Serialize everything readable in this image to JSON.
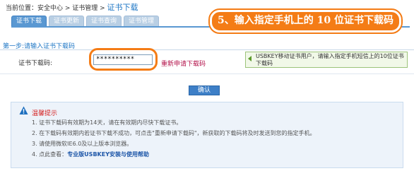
{
  "breadcrumb": {
    "prefix": "当前位置：安全中心 > 证书管理 > ",
    "current": "证书下载"
  },
  "tabs": [
    {
      "label": "证书下载",
      "active": true
    },
    {
      "label": "证书更新",
      "active": false
    },
    {
      "label": "证书查询",
      "active": false
    },
    {
      "label": "证书管理",
      "active": false
    }
  ],
  "callout": {
    "text": "5、输入指定手机上的 10 位证书下载码"
  },
  "step": {
    "title": "第一步:请输入证书下载码"
  },
  "form": {
    "label": "证书下载码:",
    "code_value": "**********",
    "redownload_link": "重新申请下载码",
    "tip": "USBKEY移动证书用户，请输入指定手机短信上的10位证书下载码"
  },
  "confirm_button": "确认",
  "notice": {
    "title": "温馨提示",
    "items": [
      "1. 证书下载码有效期为14天，请在有效期内尽快下载证书。",
      "2. 在下载码有效期内若证书下载不成功，可点击\"重新申请下载码\"，新获取的下载码将及时发送到您的指定手机。",
      "3. 请使用微软IE6.0及以上版本浏览器。",
      "4. 点此查看："
    ],
    "help_link": "专业版USBKEY安装与使用帮助"
  },
  "colors": {
    "accent_blue": "#1d76c5",
    "callout_orange": "#f47c16",
    "link_red": "#b3114a",
    "notice_red": "#d52222"
  }
}
